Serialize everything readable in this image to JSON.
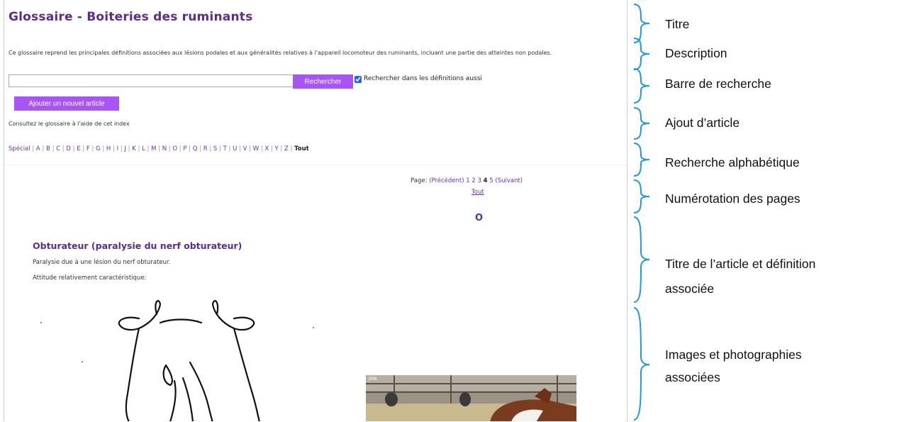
{
  "page": {
    "title": "Glossaire - Boiteries des ruminants",
    "description": "Ce glossaire reprend les principales définitions associées aux lésions podales et aux généralités relatives à l'appareil locomoteur des ruminants, incluant une partie des atteintes non podales."
  },
  "search": {
    "value": "",
    "button_label": "Rechercher",
    "checkbox_checked": true,
    "checkbox_label": "Rechercher dans les définitions aussi"
  },
  "add_article": {
    "button_label": "Ajouter un nouvel article"
  },
  "index": {
    "intro": "Consultez le glossaire à l'aide de cet index",
    "entries": [
      "Spécial",
      "A",
      "B",
      "C",
      "D",
      "E",
      "F",
      "G",
      "H",
      "I",
      "J",
      "K",
      "L",
      "M",
      "N",
      "O",
      "P",
      "Q",
      "R",
      "S",
      "T",
      "U",
      "V",
      "W",
      "X",
      "Y",
      "Z",
      "Tout"
    ],
    "current": "Tout"
  },
  "pagination": {
    "prefix": "Page:",
    "previous": "(Précédent)",
    "pages": [
      "1",
      "2",
      "3",
      "4",
      "5"
    ],
    "current_page": "4",
    "next": "(Suivant)",
    "all": "Tout"
  },
  "section_letter": "O",
  "article": {
    "title": "Obturateur (paralysie du nerf obturateur)",
    "definition": "Paralysie due à une lésion du nerf obturateur.",
    "attitude": "Attitude relativement caractéristique:",
    "photo_label": "JMN"
  },
  "annotations": [
    {
      "label": "Titre"
    },
    {
      "label": "Description"
    },
    {
      "label": "Barre de recherche"
    },
    {
      "label": "Ajout d’article"
    },
    {
      "label": "Recherche alphabétique"
    },
    {
      "label": "Numérotation des pages"
    },
    {
      "label_line1": "Titre de l’article et définition",
      "label_line2": "associée"
    },
    {
      "label_line1": "Images et photographies",
      "label_line2": "associées"
    }
  ],
  "colors": {
    "accent_button": "#a855f7",
    "heading": "#5b2d8e",
    "link": "#6b2fb3",
    "brace": "#1e9be0"
  }
}
